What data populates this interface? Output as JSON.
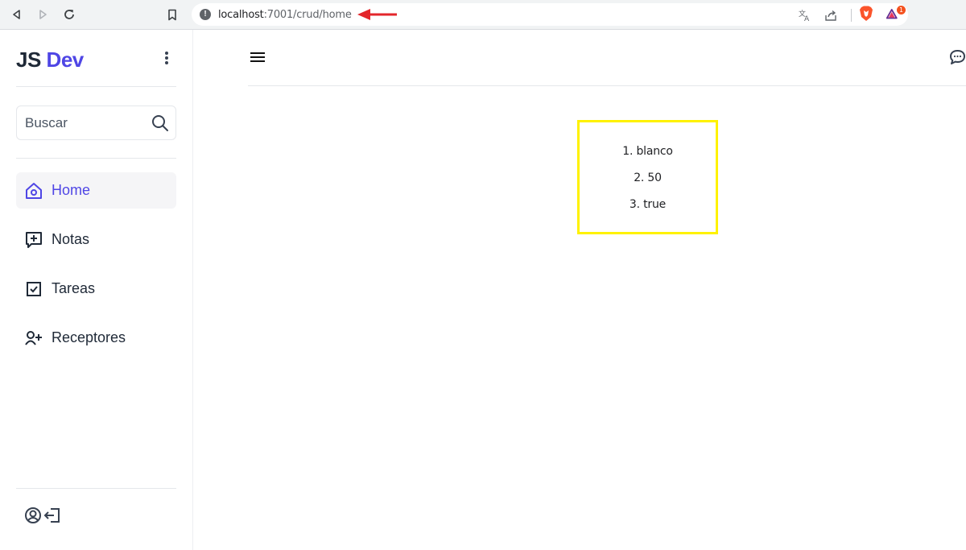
{
  "browser": {
    "url_host": "localhost",
    "url_rest": ":7001/crud/home",
    "alert_badge": "1"
  },
  "sidebar": {
    "logo_js": "JS",
    "logo_dev": "Dev",
    "search_placeholder": "Buscar",
    "items": [
      {
        "label": "Home",
        "icon": "home-icon",
        "active": true
      },
      {
        "label": "Notas",
        "icon": "note-add-icon",
        "active": false
      },
      {
        "label": "Tareas",
        "icon": "checkbox-icon",
        "active": false
      },
      {
        "label": "Receptores",
        "icon": "user-add-icon",
        "active": false
      }
    ]
  },
  "main": {
    "results": [
      "1. blanco",
      "2. 50",
      "3. true"
    ]
  },
  "colors": {
    "accent": "#4f46e5",
    "highlight_box": "#fff200",
    "annotation_arrow": "#e3262b"
  }
}
